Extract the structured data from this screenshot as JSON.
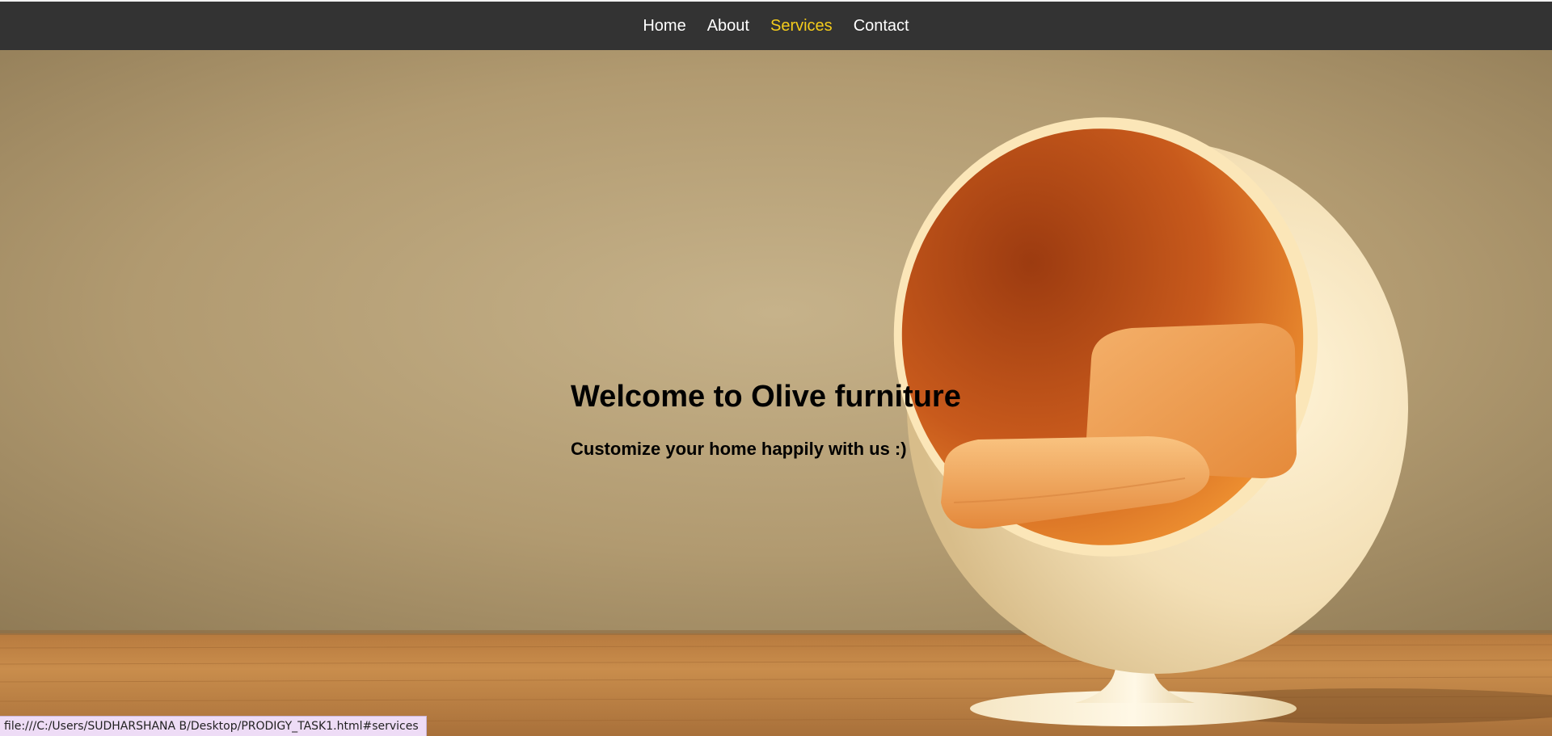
{
  "nav": {
    "items": [
      {
        "label": "Home",
        "active": false
      },
      {
        "label": "About",
        "active": false
      },
      {
        "label": "Services",
        "active": true
      },
      {
        "label": "Contact",
        "active": false
      }
    ]
  },
  "hero": {
    "title": "Welcome to Olive furniture",
    "subtitle": "Customize your home happily with us :)"
  },
  "status_bar": {
    "url": "file:///C:/Users/SUDHARSHANA B/Desktop/PRODIGY_TASK1.html#services"
  },
  "colors": {
    "nav_background": "#333333",
    "nav_text": "#ffffff",
    "nav_active": "#f5cc1b",
    "heading_text": "#000000"
  }
}
